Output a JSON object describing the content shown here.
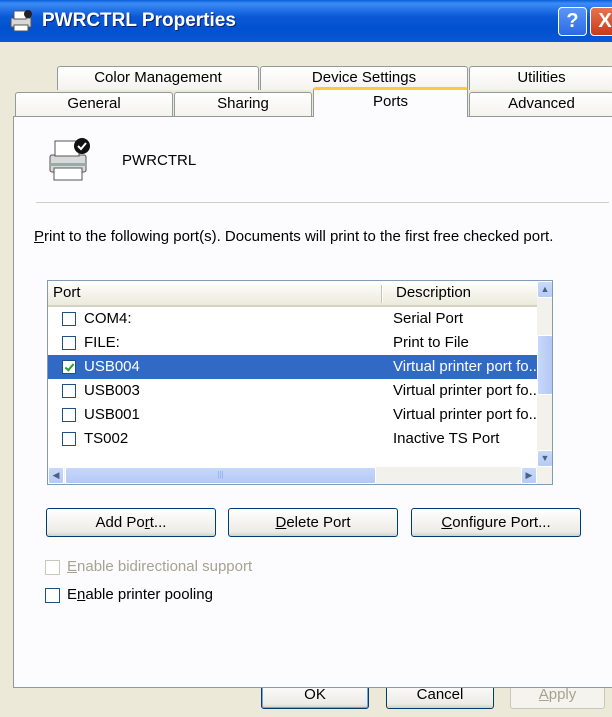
{
  "window": {
    "title": "PWRCTRL Properties",
    "help_label": "?",
    "close_label": "X"
  },
  "tabs_row1": [
    {
      "label": "Color Management"
    },
    {
      "label": "Device Settings"
    },
    {
      "label": "Utilities"
    }
  ],
  "tabs_row2": [
    {
      "label": "General"
    },
    {
      "label": "Sharing"
    },
    {
      "label": "Ports"
    },
    {
      "label": "Advanced"
    }
  ],
  "active_tab": "Ports",
  "printer": {
    "name": "PWRCTRL"
  },
  "description": {
    "first_letter": "P",
    "text_rest": "rint to the following port(s). Documents will print to the first free checked port."
  },
  "port_list": {
    "columns": [
      "Port",
      "Description"
    ],
    "rows": [
      {
        "port": "COM4:",
        "description": "Serial Port",
        "checked": false,
        "selected": false
      },
      {
        "port": "FILE:",
        "description": "Print to File",
        "checked": false,
        "selected": false
      },
      {
        "port": "USB004",
        "description": "Virtual printer port fo...",
        "checked": true,
        "selected": true
      },
      {
        "port": "USB003",
        "description": "Virtual printer port fo...",
        "checked": false,
        "selected": false
      },
      {
        "port": "USB001",
        "description": "Virtual printer port fo...",
        "checked": false,
        "selected": false
      },
      {
        "port": "TS002",
        "description": "Inactive TS Port",
        "checked": false,
        "selected": false
      }
    ]
  },
  "port_buttons": {
    "add_pre": "Add Po",
    "add_mn": "r",
    "add_post": "t...",
    "delete_mn": "D",
    "delete_post": "elete Port",
    "configure_mn": "C",
    "configure_post": "onfigure Port..."
  },
  "options": {
    "bidirectional_mn": "E",
    "bidirectional_rest": "nable bidirectional support",
    "bidirectional_enabled": false,
    "bidirectional_checked": false,
    "pooling_mn": "n",
    "pooling_pre": "E",
    "pooling_rest": "able printer pooling",
    "pooling_checked": false
  },
  "dialog_buttons": {
    "ok": "OK",
    "cancel": "Cancel",
    "apply_mn": "A",
    "apply_rest": "pply"
  },
  "colors": {
    "selection": "#316ac5",
    "titlebar": "#0a58d6",
    "tab_highlight": "#ffc83c"
  }
}
